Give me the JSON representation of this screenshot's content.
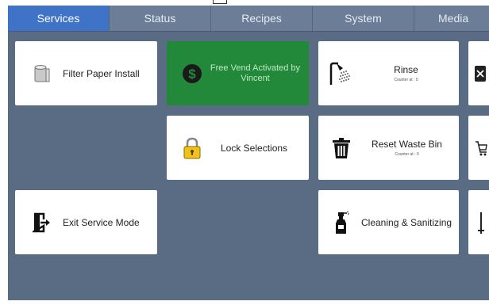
{
  "tabs": [
    {
      "label": "Services",
      "active": true
    },
    {
      "label": "Status",
      "active": false
    },
    {
      "label": "Recipes",
      "active": false
    },
    {
      "label": "System",
      "active": false
    },
    {
      "label": "Media",
      "active": false
    }
  ],
  "tiles": {
    "filter_paper": {
      "label": "Filter Paper Install",
      "icon": "filter-paper-roll-icon"
    },
    "free_vend": {
      "label": "Free Vend Activated by Vincent",
      "icon": "dollar-coin-icon"
    },
    "rinse": {
      "label": "Rinse",
      "sub": "Counter at : 0",
      "icon": "shower-icon"
    },
    "lock": {
      "label": "Lock Selections",
      "icon": "padlock-icon"
    },
    "reset_waste": {
      "label": "Reset Waste Bin",
      "sub": "Counter at : 0",
      "icon": "trash-bin-icon"
    },
    "exit_service": {
      "label": "Exit Service Mode",
      "icon": "exit-door-icon"
    },
    "cleaning": {
      "label": "Cleaning & Sanitizing",
      "icon": "spray-bottle-icon"
    }
  },
  "colors": {
    "background": "#5a6b84",
    "tab_active": "#3f73c8",
    "tile": "#ffffff",
    "free_vend_tile": "#23893a"
  }
}
